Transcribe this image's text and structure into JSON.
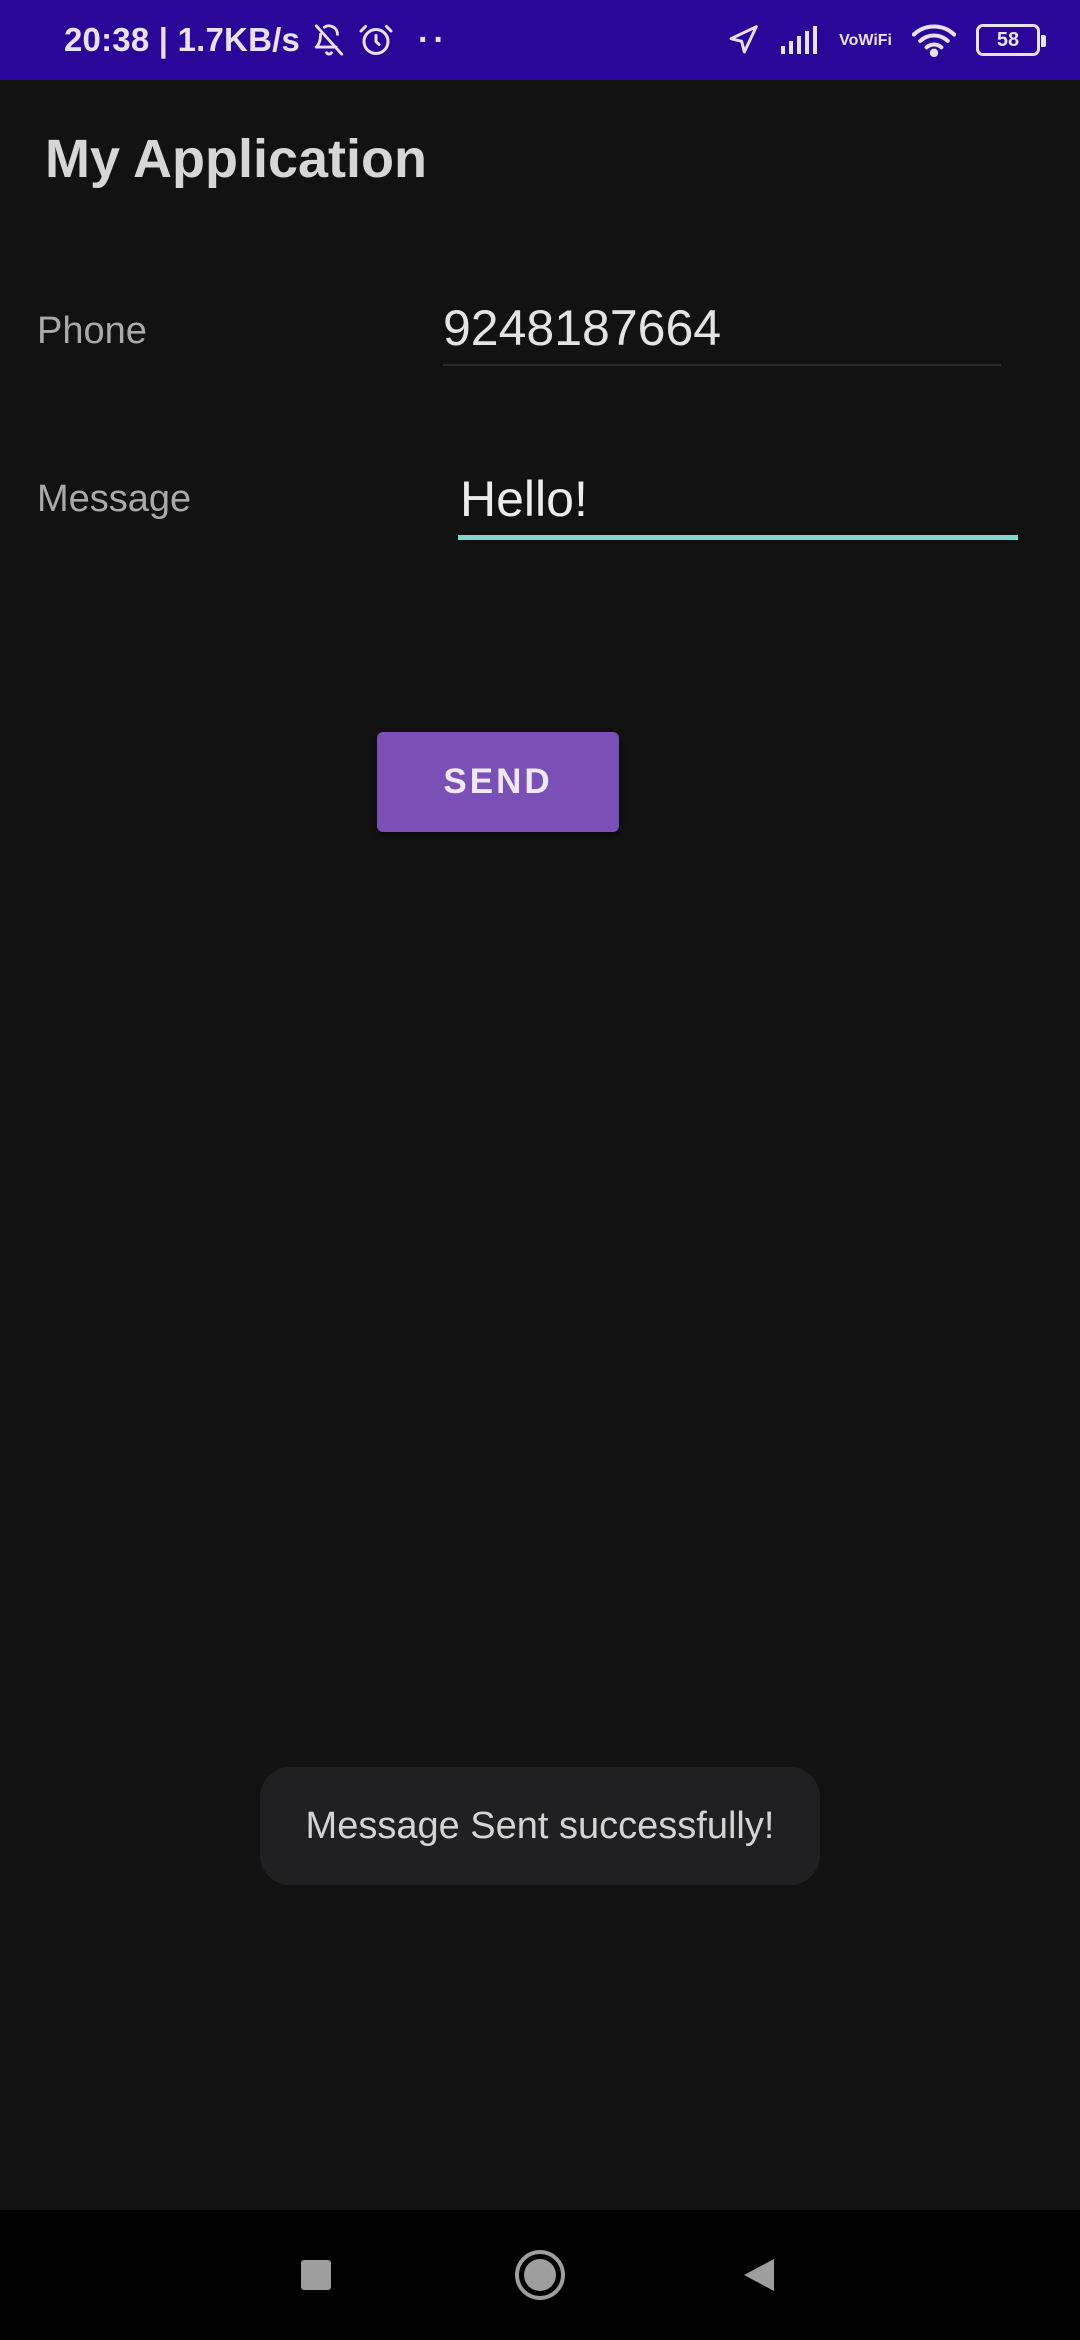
{
  "status_bar": {
    "time_speed": "20:38 | 1.7KB/s",
    "more_dots": "··",
    "vowifi_top": "Vo",
    "vowifi_bottom": "WiFi",
    "battery_level": "58",
    "background_color": "#2b0799",
    "icons": [
      "bell-off-icon",
      "alarm-icon",
      "location-arrow-icon",
      "signal-icon",
      "vowifi-icon",
      "wifi-icon",
      "battery-icon"
    ]
  },
  "app_bar": {
    "title": "My Application"
  },
  "form": {
    "phone_label": "Phone",
    "phone_value": "9248187664",
    "message_label": "Message",
    "message_value": "Hello!",
    "accent_color": "#7fd9ca"
  },
  "send_button": {
    "label": "SEND",
    "color": "#7a4fb6"
  },
  "toast": {
    "text": "Message Sent successfully!"
  },
  "nav_bar": {
    "icons": [
      "recents-square-icon",
      "home-circle-icon",
      "back-triangle-icon"
    ]
  }
}
